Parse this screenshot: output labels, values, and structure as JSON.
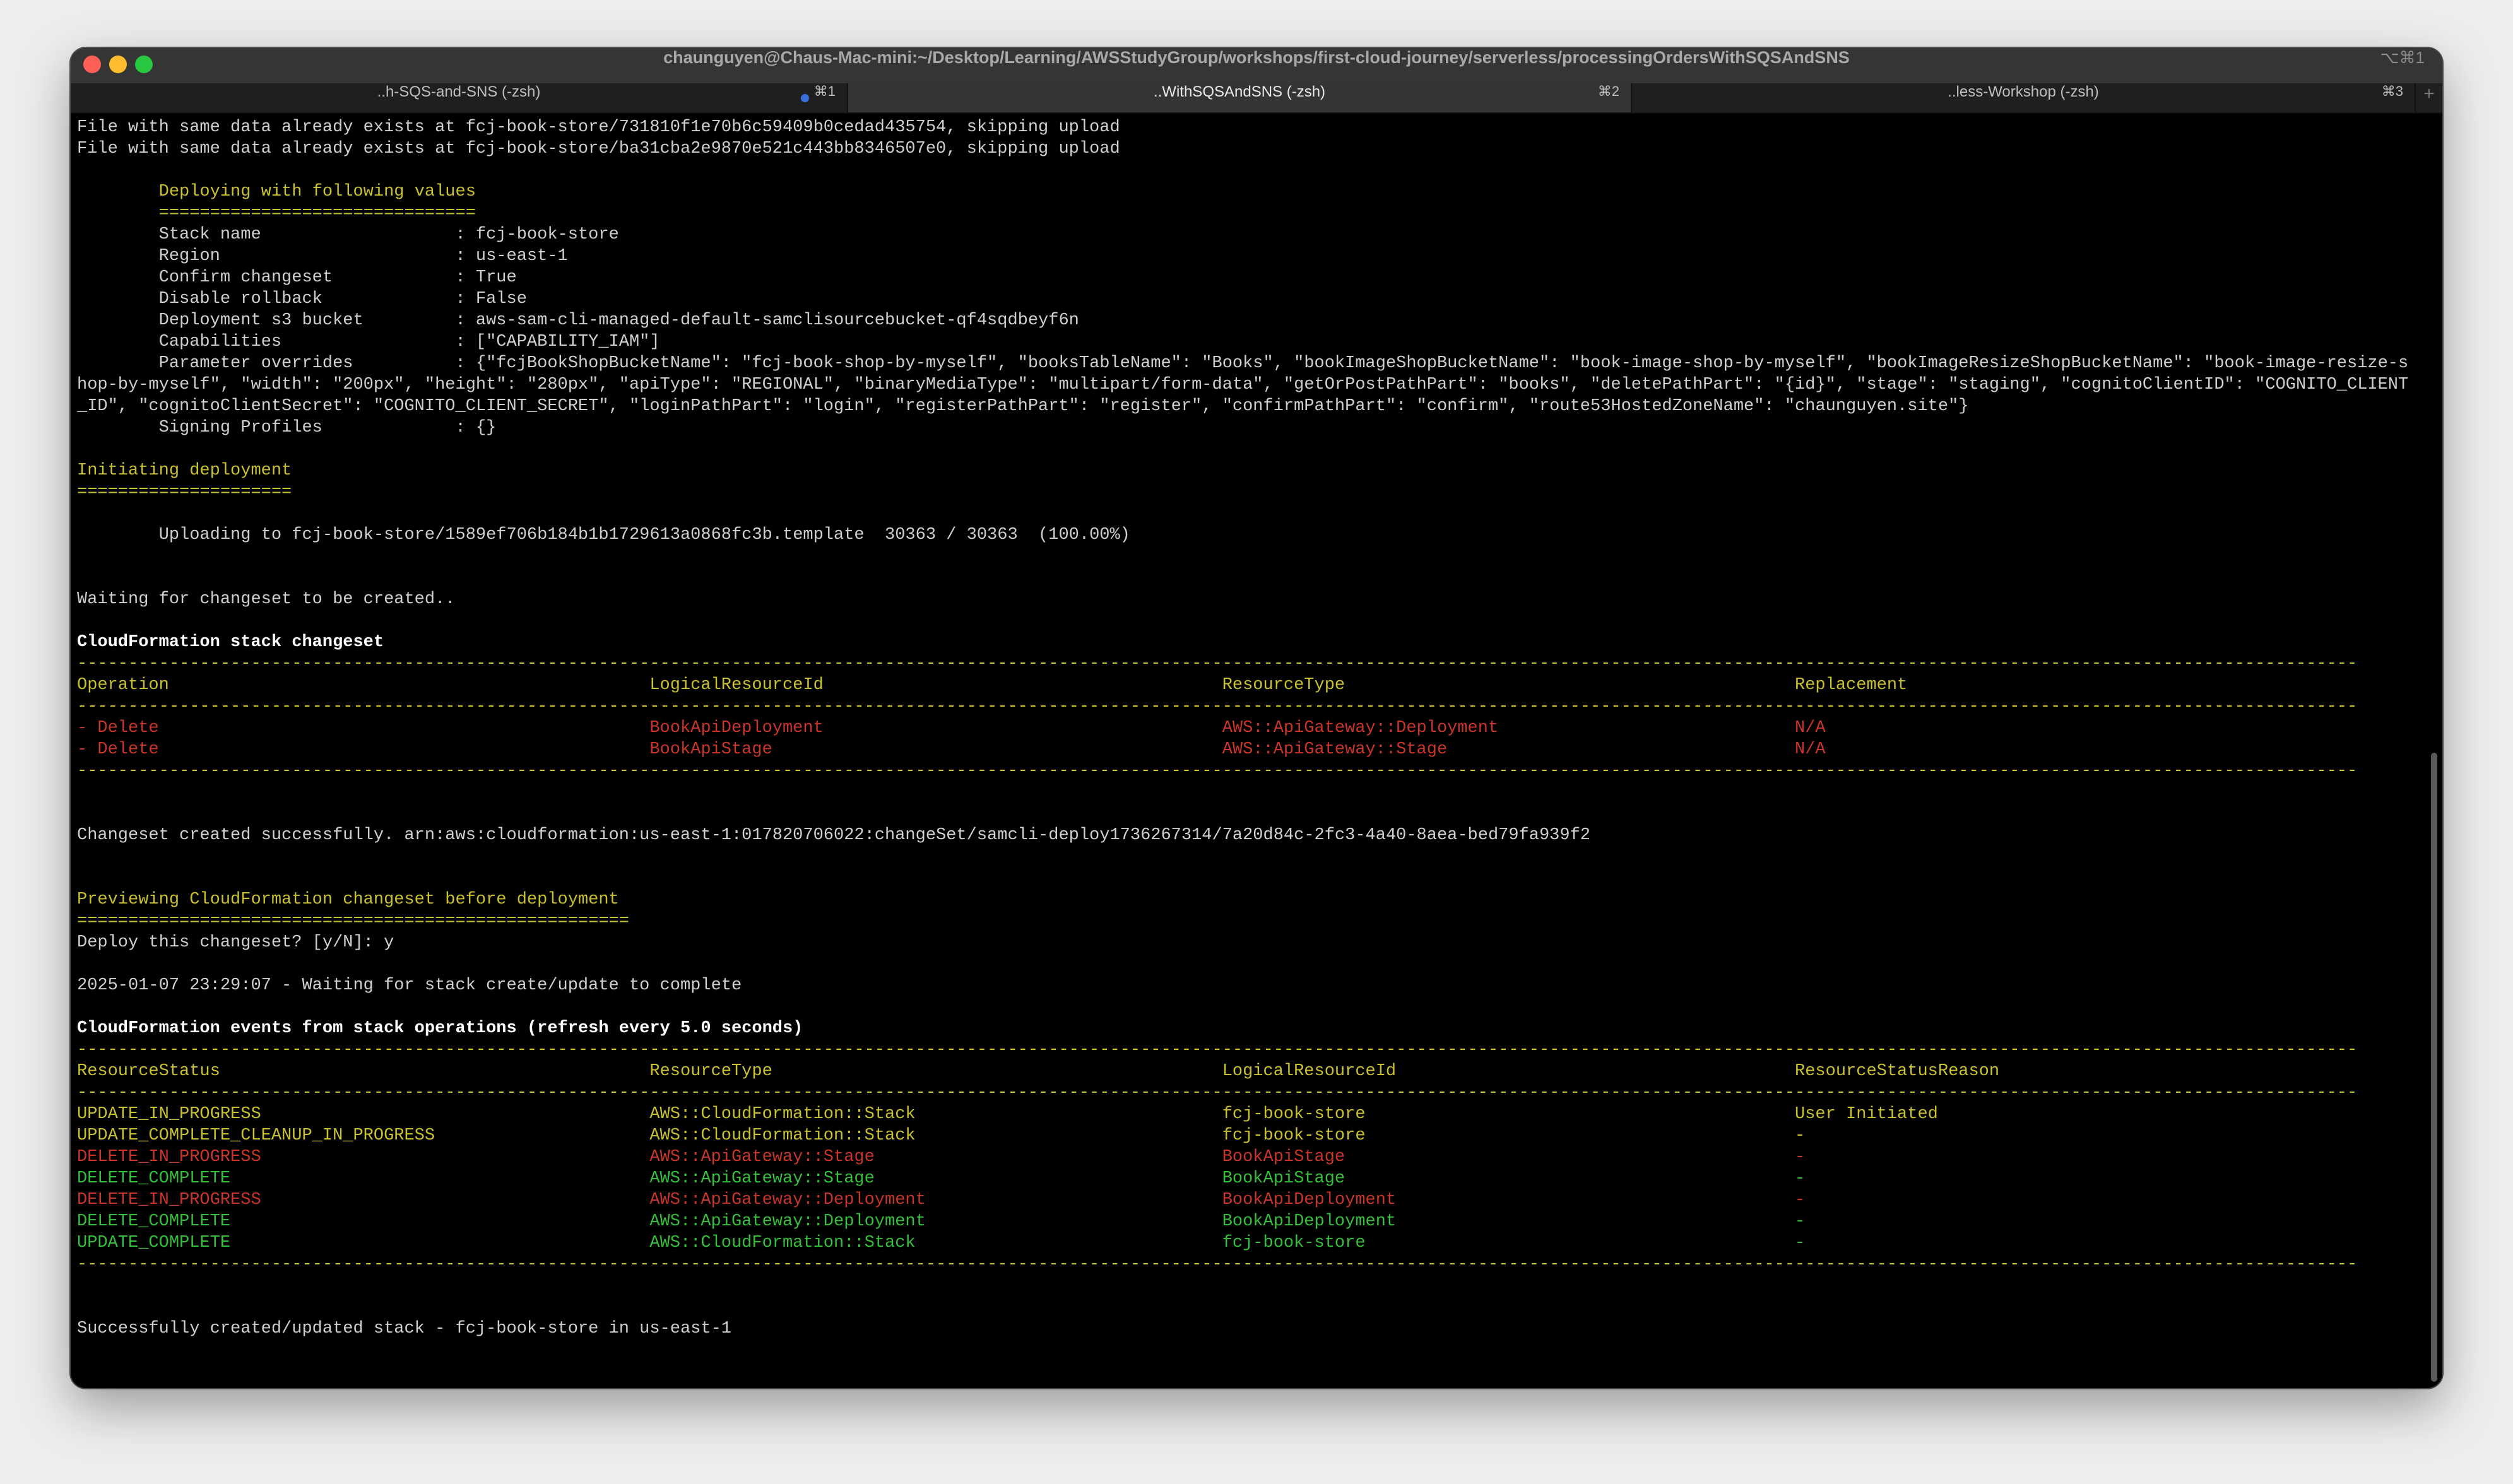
{
  "window": {
    "title": "chaunguyen@Chaus-Mac-mini:~/Desktop/Learning/AWSStudyGroup/workshops/first-cloud-journey/serverless/processingOrdersWithSQSAndSNS",
    "shortcut": "⌥⌘1",
    "lights": {
      "close": "#fe5f57",
      "minimize": "#febc2e",
      "zoom": "#28c840"
    }
  },
  "tabs": [
    {
      "label": "..h-SQS-and-SNS (-zsh)",
      "shortcut": "⌘1",
      "active": false,
      "activity_dot": true
    },
    {
      "label": "..WithSQSAndSNS (-zsh)",
      "shortcut": "⌘2",
      "active": true
    },
    {
      "label": "..less-Workshop (-zsh)",
      "shortcut": "⌘3",
      "active": false
    }
  ],
  "new_tab_label": "+",
  "colors": {
    "yellow": "#c9c12f",
    "red": "#c8352b",
    "green": "#35bf3c",
    "text": "#cfcfcf"
  },
  "terminal": {
    "lines": [
      {
        "text": "File with same data already exists at fcj-book-store/731810f1e70b6c59409b0cedad435754, skipping upload"
      },
      {
        "text": "File with same data already exists at fcj-book-store/ba31cba2e9870e521c443bb8346507e0, skipping upload"
      },
      {},
      {
        "text": "        Deploying with following values",
        "style": "yellow"
      },
      {
        "text": "        ===============================",
        "style": "yellow"
      },
      {
        "kv": [
          "Stack name",
          ": fcj-book-store"
        ]
      },
      {
        "kv": [
          "Region",
          ": us-east-1"
        ]
      },
      {
        "kv": [
          "Confirm changeset",
          ": True"
        ]
      },
      {
        "kv": [
          "Disable rollback",
          ": False"
        ]
      },
      {
        "kv": [
          "Deployment s3 bucket",
          ": aws-sam-cli-managed-default-samclisourcebucket-qf4sqdbeyf6n"
        ]
      },
      {
        "kv": [
          "Capabilities",
          ": [\"CAPABILITY_IAM\"]"
        ]
      },
      {
        "kv": [
          "Parameter overrides",
          ": {\"fcjBookShopBucketName\": \"fcj-book-shop-by-myself\", \"booksTableName\": \"Books\", \"bookImageShopBucketName\": \"book-image-shop-by-myself\", \"bookImageResizeShopBucketName\": \"book-image-resize-shop-by-myself\", \"width\": \"200px\", \"height\": \"280px\", \"apiType\": \"REGIONAL\", \"binaryMediaType\": \"multipart/form-data\", \"getOrPostPathPart\": \"books\", \"deletePathPart\": \"{id}\", \"stage\": \"staging\", \"cognitoClientID\": \"COGNITO_CLIENT_ID\", \"cognitoClientSecret\": \"COGNITO_CLIENT_SECRET\", \"loginPathPart\": \"login\", \"registerPathPart\": \"register\", \"confirmPathPart\": \"confirm\", \"route53HostedZoneName\": \"chaunguyen.site\"}"
        ]
      },
      {
        "kv": [
          "Signing Profiles",
          ": {}"
        ]
      },
      {},
      {
        "text": "Initiating deployment",
        "style": "yellow"
      },
      {
        "text": "=====================",
        "style": "yellow"
      },
      {},
      {
        "text": "        Uploading to fcj-book-store/1589ef706b184b1b1729613a0868fc3b.template  30363 / 30363  (100.00%)"
      },
      {},
      {},
      {
        "text": "Waiting for changeset to be created.."
      },
      {},
      {
        "text": "CloudFormation stack changeset",
        "style": "bold"
      },
      {
        "text": "-------------------------------------------------------------------------------------------------------------------------------------------------------------------------------------------------------------------------------",
        "style": "yellow"
      },
      {
        "cells": [
          "Operation",
          "LogicalResourceId",
          "ResourceType",
          "Replacement"
        ],
        "style": "yellow"
      },
      {
        "text": "-------------------------------------------------------------------------------------------------------------------------------------------------------------------------------------------------------------------------------",
        "style": "yellow"
      },
      {
        "cells": [
          "- Delete",
          "BookApiDeployment",
          "AWS::ApiGateway::Deployment",
          "N/A"
        ],
        "style": "red"
      },
      {
        "cells": [
          "- Delete",
          "BookApiStage",
          "AWS::ApiGateway::Stage",
          "N/A"
        ],
        "style": "red"
      },
      {
        "text": "-------------------------------------------------------------------------------------------------------------------------------------------------------------------------------------------------------------------------------",
        "style": "yellow"
      },
      {},
      {},
      {
        "text": "Changeset created successfully. arn:aws:cloudformation:us-east-1:017820706022:changeSet/samcli-deploy1736267314/7a20d84c-2fc3-4a40-8aea-bed79fa939f2"
      },
      {},
      {},
      {
        "text": "Previewing CloudFormation changeset before deployment",
        "style": "yellow"
      },
      {
        "text": "======================================================",
        "style": "yellow"
      },
      {
        "text": "Deploy this changeset? [y/N]: y"
      },
      {},
      {
        "text": "2025-01-07 23:29:07 - Waiting for stack create/update to complete"
      },
      {},
      {
        "text": "CloudFormation events from stack operations (refresh every 5.0 seconds)",
        "style": "bold"
      },
      {
        "text": "-------------------------------------------------------------------------------------------------------------------------------------------------------------------------------------------------------------------------------",
        "style": "yellow"
      },
      {
        "cells": [
          "ResourceStatus",
          "ResourceType",
          "LogicalResourceId",
          "ResourceStatusReason"
        ],
        "style": "yellow"
      },
      {
        "text": "-------------------------------------------------------------------------------------------------------------------------------------------------------------------------------------------------------------------------------",
        "style": "yellow"
      },
      {
        "cells": [
          "UPDATE_IN_PROGRESS",
          "AWS::CloudFormation::Stack",
          "fcj-book-store",
          "User Initiated"
        ],
        "style": "yellow"
      },
      {
        "cells": [
          "UPDATE_COMPLETE_CLEANUP_IN_PROGRESS",
          "AWS::CloudFormation::Stack",
          "fcj-book-store",
          "-"
        ],
        "style": "yellow"
      },
      {
        "cells": [
          "DELETE_IN_PROGRESS",
          "AWS::ApiGateway::Stage",
          "BookApiStage",
          "-"
        ],
        "style": "red"
      },
      {
        "cells": [
          "DELETE_COMPLETE",
          "AWS::ApiGateway::Stage",
          "BookApiStage",
          "-"
        ],
        "style": "green"
      },
      {
        "cells": [
          "DELETE_IN_PROGRESS",
          "AWS::ApiGateway::Deployment",
          "BookApiDeployment",
          "-"
        ],
        "style": "red"
      },
      {
        "cells": [
          "DELETE_COMPLETE",
          "AWS::ApiGateway::Deployment",
          "BookApiDeployment",
          "-"
        ],
        "style": "green"
      },
      {
        "cells": [
          "UPDATE_COMPLETE",
          "AWS::CloudFormation::Stack",
          "fcj-book-store",
          "-"
        ],
        "style": "green"
      },
      {
        "text": "-------------------------------------------------------------------------------------------------------------------------------------------------------------------------------------------------------------------------------",
        "style": "yellow"
      },
      {},
      {},
      {
        "text": "Successfully created/updated stack - fcj-book-store in us-east-1"
      }
    ]
  }
}
